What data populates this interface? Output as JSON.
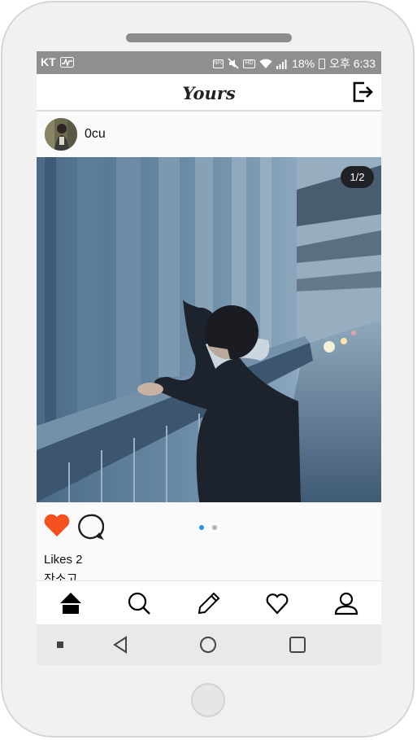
{
  "statusbar": {
    "carrier": "KT",
    "nfc": "NFC",
    "hd": "HD",
    "battery": "18%",
    "time": "오후 6:33"
  },
  "appbar": {
    "title": "Yours",
    "logout_icon": "logout-icon"
  },
  "post": {
    "username": "0cu",
    "image_counter": "1/2",
    "likes": "Likes 2",
    "caption": "잔소고",
    "liked": true,
    "carousel": {
      "active_index": 0,
      "count": 2
    }
  },
  "colors": {
    "like_red": "#f4511e",
    "active_dot": "#2196f3",
    "inactive_dot": "#b4b4b4",
    "status_bar": "#8f8f8f"
  },
  "bottom_nav": [
    "home-icon",
    "search-icon",
    "pencil-icon",
    "heart-icon",
    "profile-icon"
  ],
  "system_nav": [
    "menu-icon",
    "back-icon",
    "home-icon",
    "recents-icon"
  ]
}
